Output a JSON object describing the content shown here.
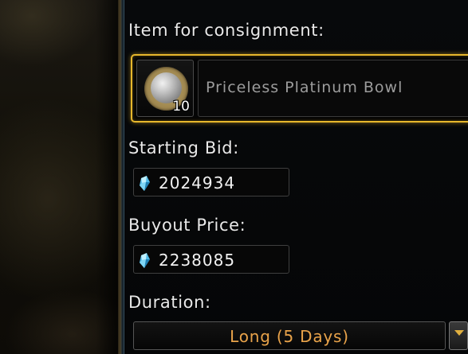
{
  "consignment": {
    "item_label": "Item for consignment:",
    "item": {
      "name": "Priceless Platinum Bowl",
      "quantity": "10",
      "icon": "platinum-bowl-icon"
    },
    "starting_bid": {
      "label": "Starting Bid:",
      "value": "2024934",
      "currency_icon": "astral-diamond-icon"
    },
    "buyout_price": {
      "label": "Buyout Price:",
      "value": "2238085",
      "currency_icon": "astral-diamond-icon"
    },
    "duration": {
      "label": "Duration:",
      "selected": "Long (5 Days)"
    }
  },
  "colors": {
    "highlight_border": "#e7b72c",
    "duration_text": "#e9a34a",
    "label_text": "#e9e9e9"
  }
}
